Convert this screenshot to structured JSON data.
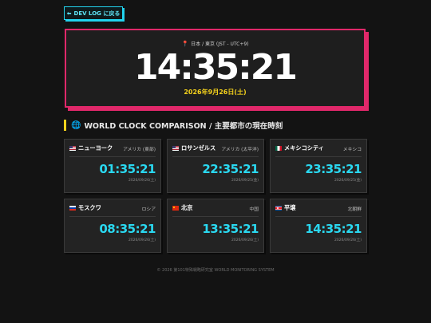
{
  "nav": {
    "back_label": "DEV LOG に戻る",
    "back_icon": "arrow-left-icon"
  },
  "hero": {
    "location": "日本 / 東京 (JST - UTC+9)",
    "time": "14:35:21",
    "date": "2026年9月26日(土)"
  },
  "section": {
    "title": "WORLD CLOCK COMPARISON / 主要都市の現在時刻"
  },
  "cities": [
    {
      "flag": "us",
      "name": "ニューヨーク",
      "country": "アメリカ (東部)",
      "time": "01:35:21",
      "date": "2026/09/26(土)"
    },
    {
      "flag": "us",
      "name": "ロサンゼルス",
      "country": "アメリカ (太平洋)",
      "time": "22:35:21",
      "date": "2026/09/25(金)"
    },
    {
      "flag": "mx",
      "name": "メキシコシティ",
      "country": "メキシコ",
      "time": "23:35:21",
      "date": "2026/09/25(金)"
    },
    {
      "flag": "ru",
      "name": "モスクワ",
      "country": "ロシア",
      "time": "08:35:21",
      "date": "2026/09/26(土)"
    },
    {
      "flag": "cn",
      "name": "北京",
      "country": "中国",
      "time": "13:35:21",
      "date": "2026/09/26(土)"
    },
    {
      "flag": "kp",
      "name": "平壌",
      "country": "北朝鮮",
      "time": "14:35:21",
      "date": "2026/09/26(土)"
    }
  ],
  "footer": {
    "text": "© 2026 第101特殊戦略研究室 WORLD MONITORING SYSTEM"
  },
  "colors": {
    "accent_cyan": "#22d3ee",
    "accent_pink": "#e0286a",
    "accent_yellow": "#f5d21c",
    "background": "#131313"
  }
}
